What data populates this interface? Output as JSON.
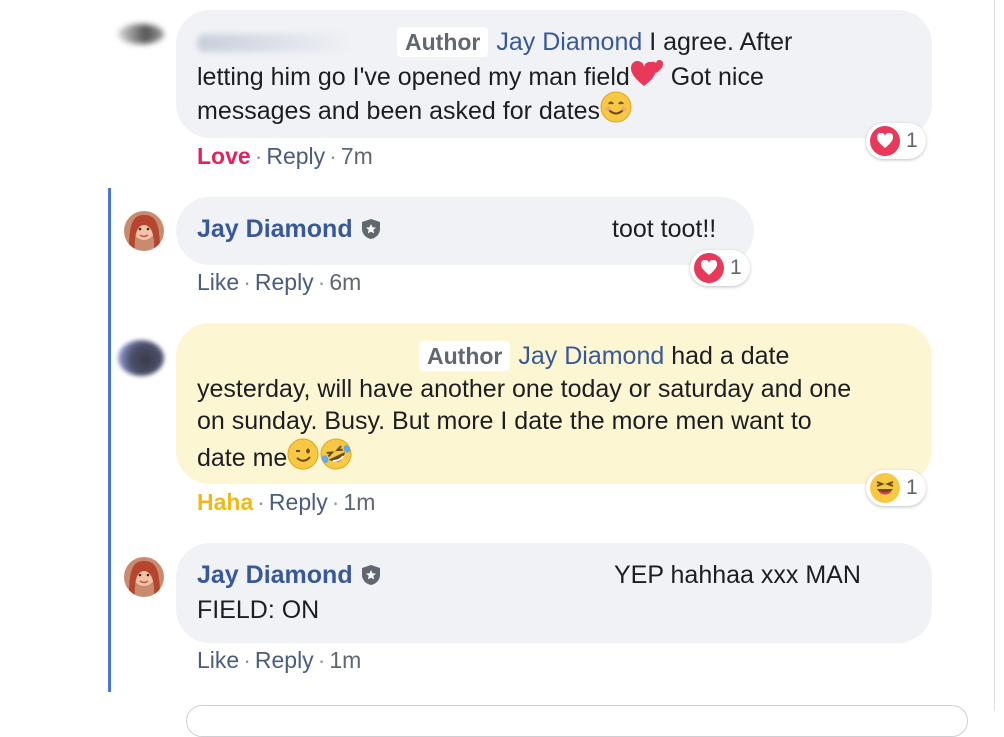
{
  "comments": [
    {
      "author_tag": "Author",
      "mention": "Jay Diamond",
      "line1_rest": " I agree. After",
      "line2": "letting him go I've opened my man field",
      "line2_tail": " Got nice",
      "line3": "messages and been asked for dates",
      "reaction_label": "Love",
      "reply_label": "Reply",
      "time": "7m",
      "reaction_count": "1"
    },
    {
      "author": "Jay Diamond",
      "body": "toot toot!!",
      "like_label": "Like",
      "reply_label": "Reply",
      "time": "6m",
      "reaction_count": "1"
    },
    {
      "author_tag": "Author",
      "mention": "Jay Diamond",
      "line1_rest": " had a date",
      "line2": "yesterday, will have another one today or saturday and one",
      "line3": "on sunday. Busy. But more I date the more men want to",
      "line4": "date me",
      "reaction_label": "Haha",
      "reply_label": "Reply",
      "time": "1m",
      "reaction_count": "1"
    },
    {
      "author": "Jay Diamond",
      "body_line1": "YEP hahhaa xxx MAN",
      "body_line2": "FIELD: ON",
      "like_label": "Like",
      "reply_label": "Reply",
      "time": "1m"
    }
  ],
  "icons": {
    "love": "heart-icon",
    "haha": "laughing-face-icon",
    "verified": "shield-star-icon",
    "sep": "·"
  },
  "colors": {
    "name_blue": "#385898",
    "love_red": "#e0245e",
    "haha_yellow": "#f0ba15",
    "thread_line": "#4a76d9",
    "highlight_bg": "#fdf6d3"
  }
}
